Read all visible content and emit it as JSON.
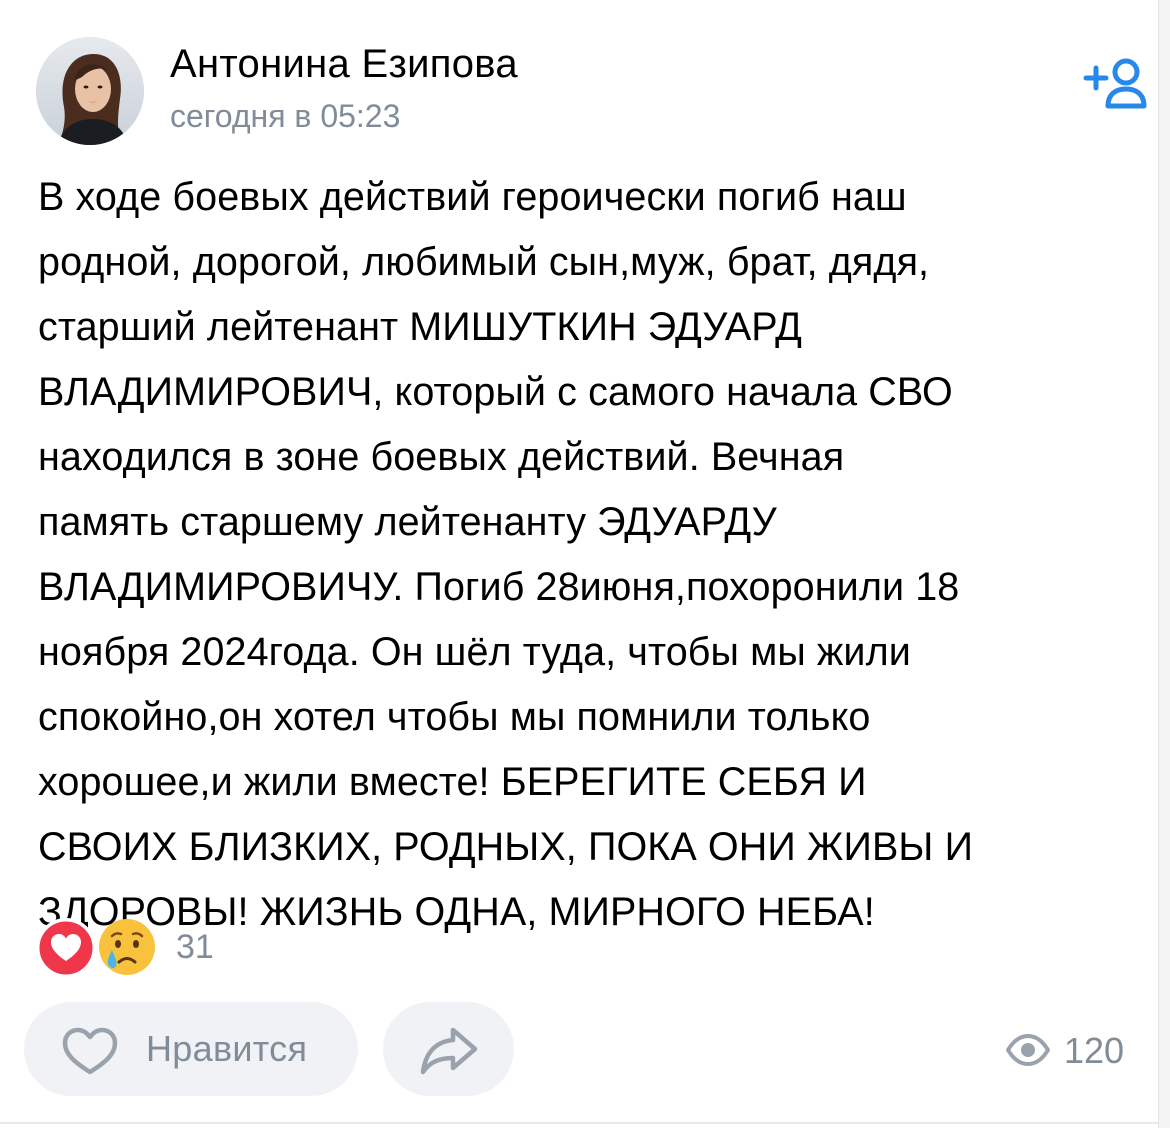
{
  "author": {
    "name": "Антонина Езипова",
    "time": "сегодня в 05:23"
  },
  "post": {
    "text": "В ходе боевых действий героически погиб наш\nродной, дорогой, любимый сын,муж, брат, дядя,\nстарший лейтенант МИШУТКИН ЭДУАРД\nВЛАДИМИРОВИЧ, который с самого начала СВО\nнаходился в зоне боевых действий. Вечная\nпамять старшему лейтенанту ЭДУАРДУ\nВЛАДИМИРОВИЧУ. Погиб 28июня,похоронили 18\nноября 2024года. Он шёл туда, чтобы мы жили\nспокойно,он хотел чтобы мы помнили только\nхорошее,и жили вместе! БЕРЕГИТЕ СЕБЯ И\nСВОИХ БЛИЗКИХ, РОДНЫХ, ПОКА ОНИ ЖИВЫ И\nЗДОРОВЫ! ЖИЗНЬ ОДНА, МИРНОГО НЕБА!"
  },
  "reactions": {
    "count": "31",
    "icons": [
      "heart-reaction-icon",
      "crying-face-reaction-icon"
    ]
  },
  "actions": {
    "like_label": "Нравится",
    "views": "120"
  },
  "colors": {
    "accent": "#2688eb",
    "secondary_text": "#818c99",
    "button_bg": "#f0f2f5",
    "heart_red": "#f0364b"
  }
}
